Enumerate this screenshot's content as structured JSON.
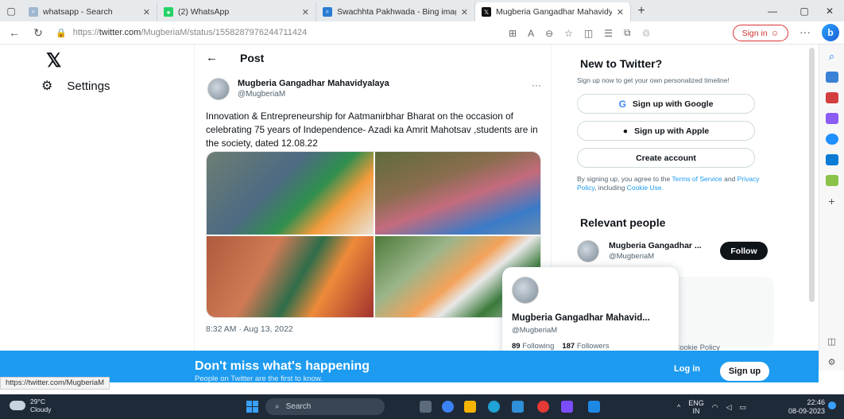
{
  "browser": {
    "tabs": [
      {
        "label": "whatsapp - Search",
        "favicon_color": "#9fb8d1"
      },
      {
        "label": "(2) WhatsApp",
        "favicon_color": "#25d366"
      },
      {
        "label": "Swachhta Pakhwada - Bing imag",
        "favicon_color": "#2b7cd3"
      },
      {
        "label": "Mugberia Gangadhar Mahavidy",
        "favicon_color": "#111111"
      }
    ],
    "new_tab": "+",
    "url_prefix": "https://",
    "url_host": "twitter.com",
    "url_path": "/MugberiaM/status/1558287976244711424",
    "signin_label": "Sign in"
  },
  "x": {
    "logo": "𝕏",
    "nav": {
      "settings": "Settings"
    }
  },
  "post": {
    "header": "Post",
    "author_name": "Mugberia Gangadhar Mahavidyalaya",
    "author_handle": "@MugberiaM",
    "text": "Innovation & Entrepreneurship for Aatmanirbhar Bharat  on the occasion of celebrating 75 years of Independence-  Azadi ka Amrit Mahotsav ,students are in the society, dated 12.08.22",
    "timestamp": "8:32 AM · Aug 13, 2022",
    "more": "···"
  },
  "right": {
    "new_title": "New to Twitter?",
    "new_sub": "Sign up now to get your own personalized timeline!",
    "google_btn": "Sign up with Google",
    "apple_btn": "Sign up with Apple",
    "create_btn": "Create account",
    "terms_pre": "By signing up, you agree to the",
    "terms_tos": "Terms of Service",
    "terms_and": "and",
    "terms_privacy": "Privacy Policy",
    "terms_incl": ", including",
    "terms_cookie": "Cookie Use.",
    "relevant_title": "Relevant people",
    "rel_name": "Mugberia Gangadhar ...",
    "rel_handle": "@MugberiaM",
    "follow": "Follow",
    "footer": "licy   Cookie Policy"
  },
  "hovercard": {
    "name": "Mugberia Gangadhar Mahavid...",
    "handle": "@MugberiaM",
    "following_count": "89",
    "following_label": "Following",
    "followers_count": "187",
    "followers_label": "Followers"
  },
  "banner": {
    "title": "Don't miss what's happening",
    "subtitle": "People on Twitter are the first to know.",
    "login": "Log in",
    "signup": "Sign up"
  },
  "status_url": "https://twitter.com/MugberiaM",
  "taskbar": {
    "temp": "29°C",
    "weather": "Cloudy",
    "search": "Search",
    "lang1": "ENG",
    "lang2": "IN",
    "time": "22:46",
    "date": "08-09-2023"
  },
  "colors": {
    "twitter_blue": "#1d9bf0",
    "text_primary": "#0f1419",
    "text_secondary": "#536471"
  }
}
